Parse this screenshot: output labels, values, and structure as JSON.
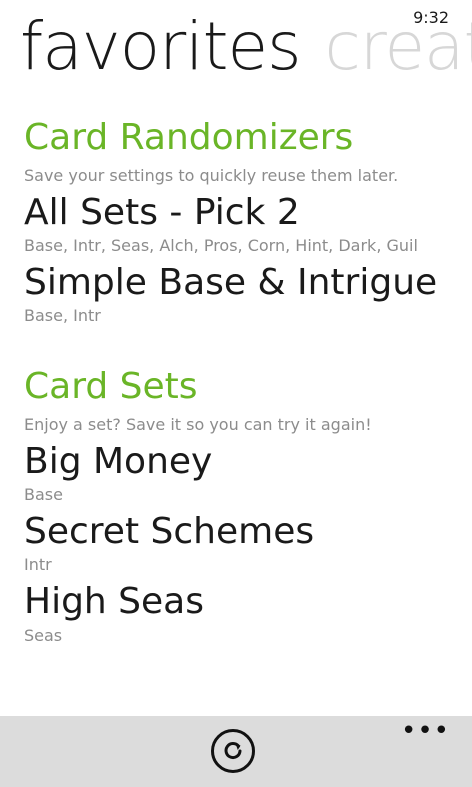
{
  "status": {
    "time": "9:32"
  },
  "pivot": {
    "active": "favorites",
    "inactive": "create"
  },
  "sections": [
    {
      "title": "Card Randomizers",
      "subtitle": "Save your settings to quickly reuse them later.",
      "items": [
        {
          "title": "All Sets - Pick 2",
          "detail": "Base, Intr, Seas, Alch, Pros, Corn, Hint, Dark, Guil"
        },
        {
          "title": "Simple Base & Intrigue",
          "detail": "Base, Intr"
        }
      ]
    },
    {
      "title": "Card Sets",
      "subtitle": "Enjoy a set? Save it so you can try it again!",
      "items": [
        {
          "title": "Big Money",
          "detail": "Base"
        },
        {
          "title": "Secret Schemes",
          "detail": "Intr"
        },
        {
          "title": "High Seas",
          "detail": "Seas"
        }
      ]
    }
  ],
  "appbar": {
    "button_icon": "refresh-icon",
    "more_icon": "more-icon",
    "more_label": "•••"
  }
}
